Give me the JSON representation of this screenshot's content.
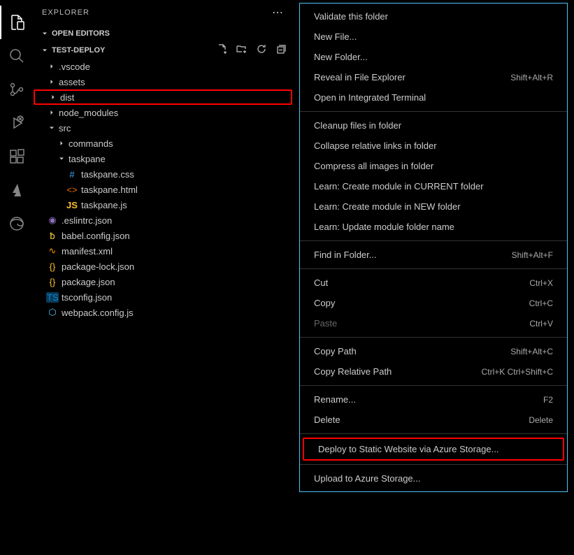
{
  "sidebar_title": "EXPLORER",
  "sections": {
    "open_editors": "OPEN EDITORS",
    "project": "TEST-DEPLOY"
  },
  "tree": {
    "vscode": ".vscode",
    "assets": "assets",
    "dist": "dist",
    "node_modules": "node_modules",
    "src": "src",
    "commands": "commands",
    "taskpane": "taskpane",
    "taskpane_css": "taskpane.css",
    "taskpane_html": "taskpane.html",
    "taskpane_js": "taskpane.js",
    "eslintrc": ".eslintrc.json",
    "babel": "babel.config.json",
    "manifest": "manifest.xml",
    "package_lock": "package-lock.json",
    "package": "package.json",
    "tsconfig": "tsconfig.json",
    "webpack": "webpack.config.js"
  },
  "menu": {
    "validate": "Validate this folder",
    "new_file": "New File...",
    "new_folder": "New Folder...",
    "reveal": "Reveal in File Explorer",
    "reveal_key": "Shift+Alt+R",
    "open_terminal": "Open in Integrated Terminal",
    "cleanup": "Cleanup files in folder",
    "collapse": "Collapse relative links in folder",
    "compress": "Compress all images in folder",
    "learn_current": "Learn: Create module in CURRENT folder",
    "learn_new": "Learn: Create module in NEW folder",
    "learn_update": "Learn: Update module folder name",
    "find": "Find in Folder...",
    "find_key": "Shift+Alt+F",
    "cut": "Cut",
    "cut_key": "Ctrl+X",
    "copy": "Copy",
    "copy_key": "Ctrl+C",
    "paste": "Paste",
    "paste_key": "Ctrl+V",
    "copy_path": "Copy Path",
    "copy_path_key": "Shift+Alt+C",
    "copy_rel": "Copy Relative Path",
    "copy_rel_key": "Ctrl+K Ctrl+Shift+C",
    "rename": "Rename...",
    "rename_key": "F2",
    "delete": "Delete",
    "delete_key": "Delete",
    "deploy_static": "Deploy to Static Website via Azure Storage...",
    "upload_azure": "Upload to Azure Storage..."
  }
}
